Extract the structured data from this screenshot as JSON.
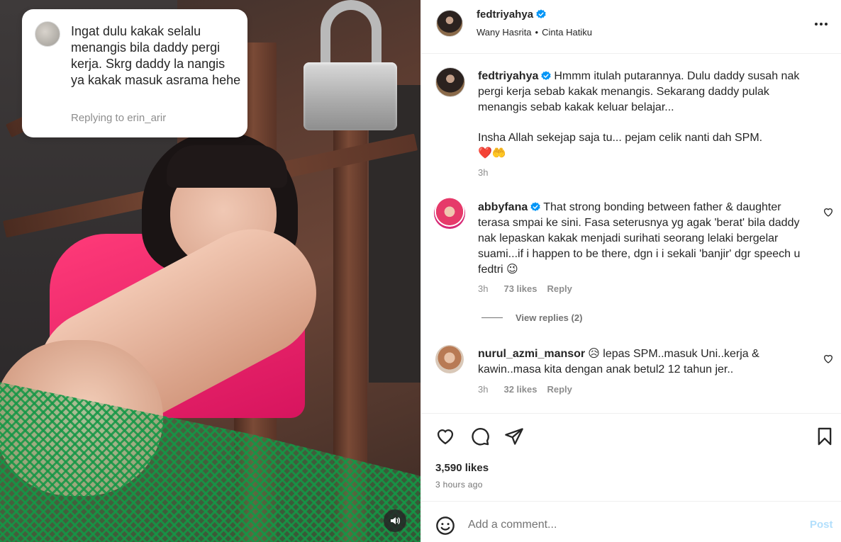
{
  "reply_bubble": {
    "text": "Ingat dulu kakak selalu menangis bila daddy pergi kerja. Skrg daddy la nangis ya kakak masuk asrama hehe",
    "replying_to": "Replying to erin_arir"
  },
  "header": {
    "username": "fedtriyahya",
    "subtitle_artist": "Wany Hasrita",
    "subtitle_song": "Cinta Hatiku"
  },
  "caption": {
    "username": "fedtriyahya",
    "text_1": "Hmmm itulah putarannya. Dulu daddy susah nak pergi kerja sebab kakak menangis. Sekarang daddy pulak menangis sebab kakak keluar belajar...",
    "text_2": "Insha Allah sekejap saja tu... pejam celik nanti dah SPM.",
    "emojis": "❤️🤲",
    "time": "3h"
  },
  "comments": [
    {
      "username": "abbyfana",
      "text": "That strong bonding between father & daughter terasa smpai ke sini. Fasa seterusnya yg agak 'berat' bila daddy nak lepaskan kakak menjadi surihati seorang lelaki bergelar suami...if i happen to be there, dgn i i sekali 'banjir' dgr speech u fedtri 😉",
      "time": "3h",
      "likes": "73 likes",
      "reply": "Reply",
      "view_replies": "View replies (2)"
    },
    {
      "username": "nurul_azmi_mansor",
      "text": "😥 lepas SPM..masuk Uni..kerja & kawin..masa kita dengan anak betul2 12 tahun jer..",
      "time": "3h",
      "likes": "32 likes",
      "reply": "Reply"
    }
  ],
  "post_stats": {
    "likes": "3,590 likes",
    "time": "3 hours ago"
  },
  "add_comment": {
    "placeholder": "Add a comment...",
    "post_label": "Post"
  },
  "colors": {
    "verified": "#0095f6",
    "text": "#262626",
    "muted": "#8e8e8e",
    "post_disabled": "#b2dffc"
  },
  "icons": [
    "verified-icon",
    "more-icon",
    "heart-icon",
    "comment-icon",
    "share-icon",
    "save-icon",
    "emoji-icon",
    "sound-icon"
  ]
}
